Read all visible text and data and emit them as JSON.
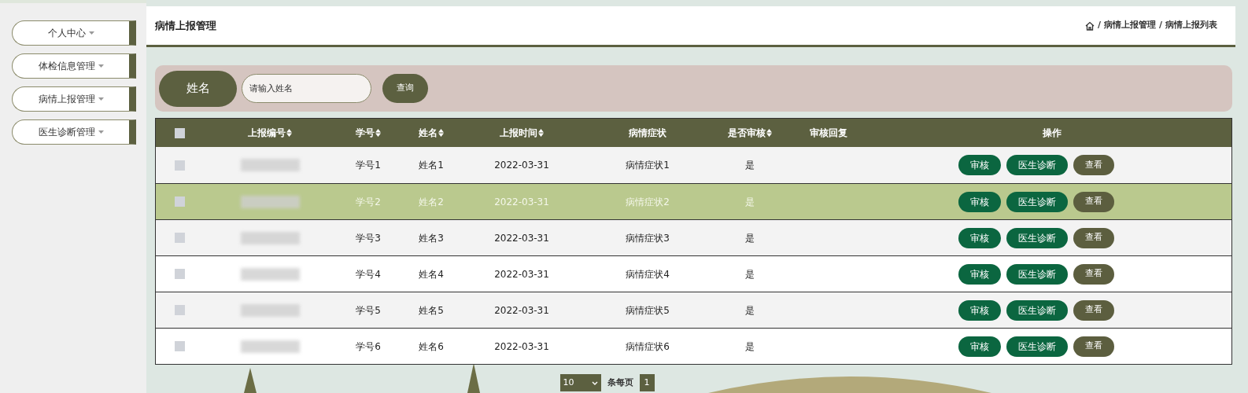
{
  "sidebar": {
    "items": [
      {
        "label": "个人中心"
      },
      {
        "label": "体检信息管理"
      },
      {
        "label": "病情上报管理"
      },
      {
        "label": "医生诊断管理"
      }
    ]
  },
  "header": {
    "title": "病情上报管理",
    "separator": "/",
    "breadcrumb": [
      "病情上报管理",
      "病情上报列表"
    ]
  },
  "search": {
    "label": "姓名",
    "placeholder": "请输入姓名",
    "button": "查询"
  },
  "table": {
    "select_all_checked": false,
    "columns": [
      {
        "label": "上报编号",
        "sortable": true
      },
      {
        "label": "学号",
        "sortable": true
      },
      {
        "label": "姓名",
        "sortable": true
      },
      {
        "label": "上报时间",
        "sortable": true
      },
      {
        "label": "病情症状",
        "sortable": false
      },
      {
        "label": "是否审核",
        "sortable": true
      },
      {
        "label": "审核回复",
        "sortable": false
      },
      {
        "label": "操作",
        "sortable": false
      }
    ],
    "rows": [
      {
        "checked": false,
        "highlighted": false,
        "cells": [
          "",
          "学号1",
          "姓名1",
          "2022-03-31",
          "病情症状1",
          "是",
          ""
        ],
        "actions": [
          {
            "label": "审核",
            "kind": "primary"
          },
          {
            "label": "医生诊断",
            "kind": "primary"
          },
          {
            "label": "查看",
            "kind": "secondary"
          }
        ]
      },
      {
        "checked": false,
        "highlighted": true,
        "cells": [
          "",
          "学号2",
          "姓名2",
          "2022-03-31",
          "病情症状2",
          "是",
          ""
        ],
        "actions": [
          {
            "label": "审核",
            "kind": "primary"
          },
          {
            "label": "医生诊断",
            "kind": "primary"
          },
          {
            "label": "查看",
            "kind": "secondary"
          }
        ]
      },
      {
        "checked": false,
        "highlighted": false,
        "cells": [
          "",
          "学号3",
          "姓名3",
          "2022-03-31",
          "病情症状3",
          "是",
          ""
        ],
        "actions": [
          {
            "label": "审核",
            "kind": "primary"
          },
          {
            "label": "医生诊断",
            "kind": "primary"
          },
          {
            "label": "查看",
            "kind": "secondary"
          }
        ]
      },
      {
        "checked": false,
        "highlighted": false,
        "cells": [
          "",
          "学号4",
          "姓名4",
          "2022-03-31",
          "病情症状4",
          "是",
          ""
        ],
        "actions": [
          {
            "label": "审核",
            "kind": "primary"
          },
          {
            "label": "医生诊断",
            "kind": "primary"
          },
          {
            "label": "查看",
            "kind": "secondary"
          }
        ]
      },
      {
        "checked": false,
        "highlighted": false,
        "cells": [
          "",
          "学号5",
          "姓名5",
          "2022-03-31",
          "病情症状5",
          "是",
          ""
        ],
        "actions": [
          {
            "label": "审核",
            "kind": "primary"
          },
          {
            "label": "医生诊断",
            "kind": "primary"
          },
          {
            "label": "查看",
            "kind": "secondary"
          }
        ]
      },
      {
        "checked": false,
        "highlighted": false,
        "cells": [
          "",
          "学号6",
          "姓名6",
          "2022-03-31",
          "病情症状6",
          "是",
          ""
        ],
        "actions": [
          {
            "label": "审核",
            "kind": "primary"
          },
          {
            "label": "医生诊断",
            "kind": "primary"
          },
          {
            "label": "查看",
            "kind": "secondary"
          }
        ]
      }
    ]
  },
  "pagination": {
    "page_size": "10",
    "page_size_label": "条每页",
    "pages": [
      {
        "label": "1",
        "selected": true
      }
    ]
  }
}
